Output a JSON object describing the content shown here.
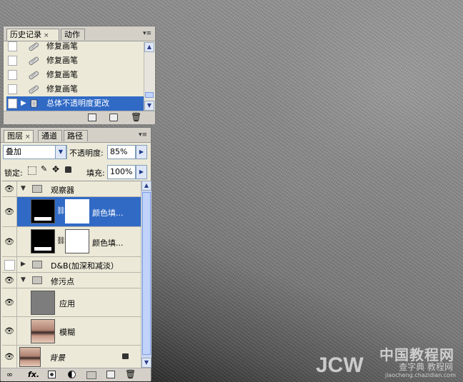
{
  "history_panel": {
    "tabs": [
      {
        "label": "历史记录",
        "close": "×"
      },
      {
        "label": "动作"
      }
    ],
    "items": [
      {
        "label": "修复画笔",
        "icon": "healing-brush-icon"
      },
      {
        "label": "修复画笔",
        "icon": "healing-brush-icon"
      },
      {
        "label": "修复画笔",
        "icon": "healing-brush-icon"
      },
      {
        "label": "修复画笔",
        "icon": "healing-brush-icon"
      },
      {
        "label": "总体不透明度更改",
        "icon": "opacity-change-icon",
        "selected": true
      }
    ],
    "footer_icons": [
      "new-document-from-state-icon",
      "snapshot-icon",
      "delete-icon"
    ]
  },
  "layers_panel": {
    "tabs": [
      {
        "label": "图层",
        "close": "×"
      },
      {
        "label": "通道"
      },
      {
        "label": "路径"
      }
    ],
    "blend_mode": "叠加",
    "opacity_label": "不透明度:",
    "opacity_value": "85%",
    "lock_label": "锁定:",
    "fill_label": "填充:",
    "fill_value": "100%",
    "layers": [
      {
        "name": "观察器",
        "type": "group",
        "expanded": true
      },
      {
        "name": "颜色填...",
        "type": "adjustment",
        "selected": true
      },
      {
        "name": "颜色填...",
        "type": "adjustment"
      },
      {
        "name": "D&B(加深和减淡）",
        "type": "group",
        "expanded": false,
        "visible": false
      },
      {
        "name": "修污点",
        "type": "group",
        "expanded": true
      },
      {
        "name": "应用",
        "type": "layer"
      },
      {
        "name": "模糊",
        "type": "layer"
      },
      {
        "name": "背景",
        "type": "background",
        "locked": true
      }
    ],
    "footer": {
      "fx_label": "fx."
    },
    "footer_icons": [
      "link-layers-icon",
      "fx-icon",
      "add-mask-icon",
      "adjustment-layer-icon",
      "new-group-icon",
      "new-layer-icon",
      "delete-layer-icon"
    ]
  },
  "watermark": {
    "line1": "中国教程网",
    "line2": "JCW",
    "line3": "jiaocheng.chazidian.com",
    "line4": "查字典 教程网"
  },
  "colors": {
    "selection": "#316ac5",
    "panel_bg": "#ece9d8",
    "tabbar_bg": "#d4d0c8"
  }
}
